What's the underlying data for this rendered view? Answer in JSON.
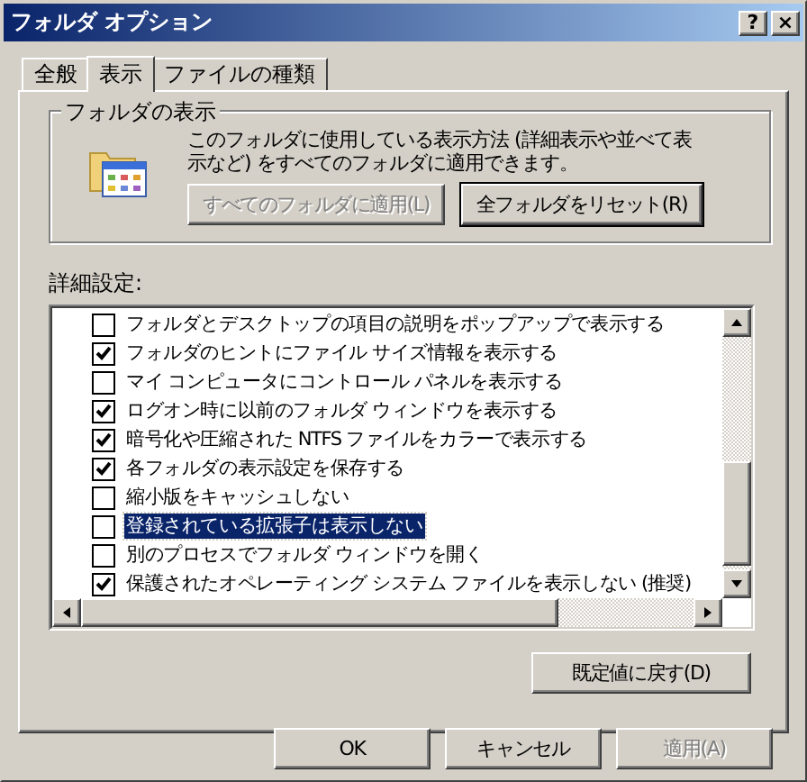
{
  "window": {
    "title": "フォルダ オプション",
    "controls": [
      {
        "kind": "help",
        "label": "?"
      },
      {
        "kind": "close",
        "label": "×"
      }
    ]
  },
  "tabs": [
    {
      "label": "全般",
      "selected": false
    },
    {
      "label": "表示",
      "selected": true
    },
    {
      "label": "ファイルの種類",
      "selected": false
    }
  ],
  "folder_views": {
    "title": "フォルダの表示",
    "description": "このフォルダに使用している表示方法 (詳細表示や並べて表示など) をすべてのフォルダに適用できます。",
    "buttons": [
      {
        "label": "すべてのフォルダに適用(L)",
        "disabled": true
      },
      {
        "label": "全フォルダをリセット(R)",
        "disabled": false
      }
    ]
  },
  "advanced": {
    "label": "詳細設定:",
    "items": [
      {
        "label": "フォルダとデスクトップの項目の説明をポップアップで表示する",
        "checked": false,
        "selected": false
      },
      {
        "label": "フォルダのヒントにファイル サイズ情報を表示する",
        "checked": true,
        "selected": false
      },
      {
        "label": "マイ コンピュータにコントロール パネルを表示する",
        "checked": false,
        "selected": false
      },
      {
        "label": "ログオン時に以前のフォルダ ウィンドウを表示する",
        "checked": true,
        "selected": false
      },
      {
        "label": "暗号化や圧縮された NTFS ファイルをカラーで表示する",
        "checked": true,
        "selected": false
      },
      {
        "label": "各フォルダの表示設定を保存する",
        "checked": true,
        "selected": false
      },
      {
        "label": "縮小版をキャッシュしない",
        "checked": false,
        "selected": false
      },
      {
        "label": "登録されている拡張子は表示しない",
        "checked": false,
        "selected": true
      },
      {
        "label": "別のプロセスでフォルダ ウィンドウを開く",
        "checked": false,
        "selected": false
      },
      {
        "label": "保護されたオペレーティング システム ファイルを表示しない (推奨)",
        "checked": true,
        "selected": false
      }
    ],
    "restore_button": {
      "label": "既定値に戻す(D)",
      "disabled": false
    }
  },
  "footer_buttons": [
    {
      "label": "OK",
      "disabled": false
    },
    {
      "label": "キャンセル",
      "disabled": false
    },
    {
      "label": "適用(A)",
      "disabled": true
    }
  ]
}
